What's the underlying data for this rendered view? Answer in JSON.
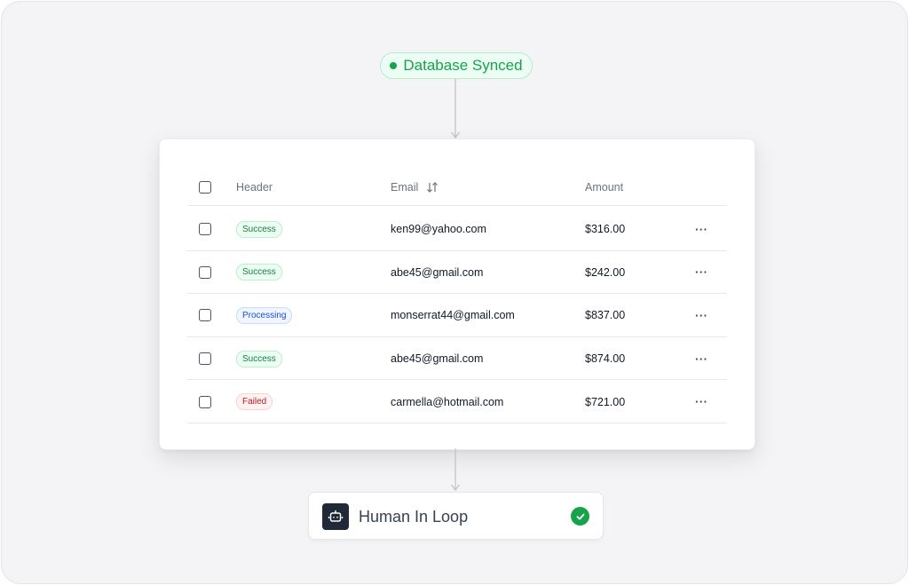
{
  "sync_status": {
    "label": "Database Synced",
    "color": "#16a34a"
  },
  "table": {
    "columns": {
      "header": "Header",
      "email": "Email",
      "amount": "Amount"
    },
    "rows": [
      {
        "status": "Success",
        "status_kind": "success",
        "email": "ken99@yahoo.com",
        "amount": "$316.00"
      },
      {
        "status": "Success",
        "status_kind": "success",
        "email": "abe45@gmail.com",
        "amount": "$242.00"
      },
      {
        "status": "Processing",
        "status_kind": "processing",
        "email": "monserrat44@gmail.com",
        "amount": "$837.00"
      },
      {
        "status": "Success",
        "status_kind": "success",
        "email": "abe45@gmail.com",
        "amount": "$874.00"
      },
      {
        "status": "Failed",
        "status_kind": "failed",
        "email": "carmella@hotmail.com",
        "amount": "$721.00"
      }
    ],
    "row_menu_glyph": "···",
    "sort_icon": "sort-arrows-icon"
  },
  "status_styles": {
    "success": {
      "bg": "#ecfdf3",
      "border": "#bbf0cd",
      "text": "#15803d"
    },
    "processing": {
      "bg": "#eff6ff",
      "border": "#c7ddfb",
      "text": "#1d4ed8"
    },
    "failed": {
      "bg": "#fef2f2",
      "border": "#fbd0d0",
      "text": "#b91c1c"
    }
  },
  "human_in_loop": {
    "label": "Human In Loop",
    "icon": "robot-icon",
    "status_icon": "check-circle-icon"
  }
}
